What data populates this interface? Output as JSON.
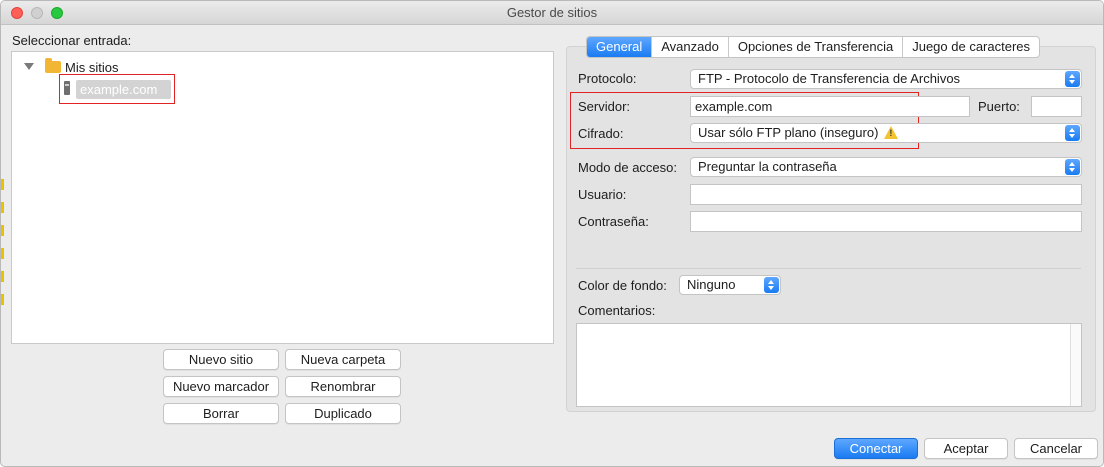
{
  "window": {
    "title": "Gestor de sitios"
  },
  "left": {
    "select_label": "Seleccionar entrada:",
    "tree": {
      "root_label": "Mis sitios",
      "site_label": "example.com"
    },
    "buttons": {
      "new_site": "Nuevo sitio",
      "new_folder": "Nueva carpeta",
      "new_bookmark": "Nuevo marcador",
      "rename": "Renombrar",
      "delete": "Borrar",
      "duplicate": "Duplicado"
    }
  },
  "tabs": [
    "General",
    "Avanzado",
    "Opciones de Transferencia",
    "Juego de caracteres"
  ],
  "form": {
    "protocol_label": "Protocolo:",
    "protocol_value": "FTP - Protocolo de Transferencia de Archivos",
    "server_label": "Servidor:",
    "server_value": "example.com",
    "port_label": "Puerto:",
    "port_value": "",
    "encryption_label": "Cifrado:",
    "encryption_value": "Usar sólo FTP plano (inseguro)",
    "access_label": "Modo de acceso:",
    "access_value": "Preguntar la contraseña",
    "user_label": "Usuario:",
    "user_value": "",
    "password_label": "Contraseña:",
    "password_value": "",
    "bg_color_label": "Color de fondo:",
    "bg_color_value": "Ninguno",
    "comments_label": "Comentarios:"
  },
  "footer": {
    "connect": "Conectar",
    "ok": "Aceptar",
    "cancel": "Cancelar"
  },
  "colors": {
    "accent": "#1a7bf2",
    "highlight_box": "#e02424",
    "warning": "#f4c430"
  },
  "icons": [
    "folder-icon",
    "server-icon",
    "disclosure-triangle-icon",
    "warning-icon",
    "dropdown-stepper-icon"
  ]
}
